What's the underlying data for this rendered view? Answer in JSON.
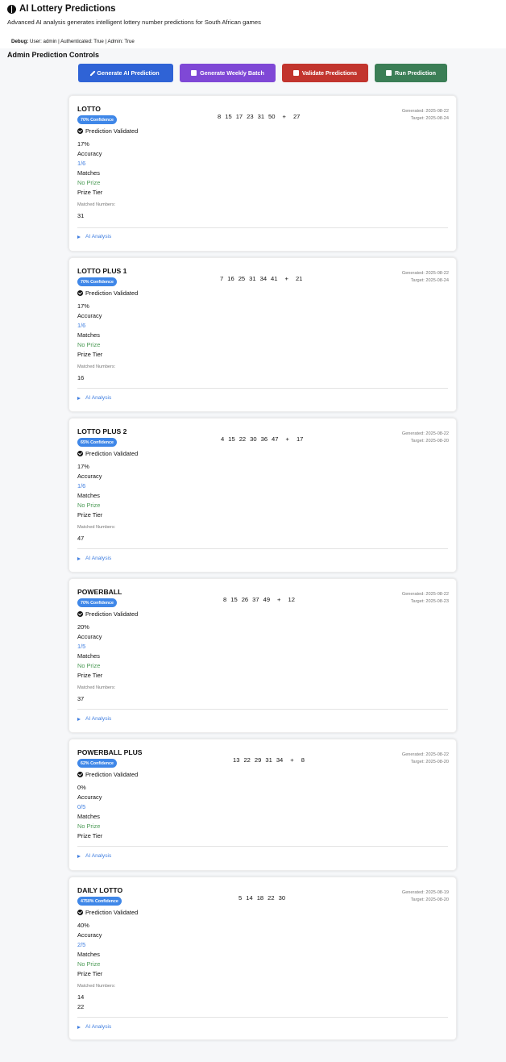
{
  "app": {
    "title": "AI Lottery Predictions",
    "subtitle": "Advanced AI analysis generates intelligent lottery number predictions for South African games",
    "debug_label": "Debug:",
    "debug_text": "User: admin | Authenticated: True | Admin: True",
    "admin_title": "Admin Prediction Controls"
  },
  "buttons": {
    "generate": "Generate AI Prediction",
    "weekly": "Generate Weekly Batch",
    "validate": "Validate Predictions",
    "run": "Run Prediction"
  },
  "labels": {
    "validated": "Prediction Validated",
    "accuracy": "Accuracy",
    "matches": "Matches",
    "prize_tier": "Prize Tier",
    "matched_numbers": "Matched Numbers:",
    "ai_analysis": "AI Analysis"
  },
  "cards": [
    {
      "name": "LOTTO",
      "confidence": "70% Confidence",
      "numbers": [
        "8",
        "15",
        "17",
        "23",
        "31",
        "50"
      ],
      "plus": "+",
      "bonus": "27",
      "generated": "Generated: 2025-08-22",
      "target": "Target: 2025-08-24",
      "accuracy": "17%",
      "matches": "1/6",
      "prize": "No Prize",
      "matched": [
        "31"
      ]
    },
    {
      "name": "LOTTO PLUS 1",
      "confidence": "70% Confidence",
      "numbers": [
        "7",
        "16",
        "25",
        "31",
        "34",
        "41"
      ],
      "plus": "+",
      "bonus": "21",
      "generated": "Generated: 2025-08-22",
      "target": "Target: 2025-08-24",
      "accuracy": "17%",
      "matches": "1/6",
      "prize": "No Prize",
      "matched": [
        "16"
      ]
    },
    {
      "name": "LOTTO PLUS 2",
      "confidence": "65% Confidence",
      "numbers": [
        "4",
        "15",
        "22",
        "30",
        "36",
        "47"
      ],
      "plus": "+",
      "bonus": "17",
      "generated": "Generated: 2025-08-22",
      "target": "Target: 2025-08-20",
      "accuracy": "17%",
      "matches": "1/6",
      "prize": "No Prize",
      "matched": [
        "47"
      ]
    },
    {
      "name": "POWERBALL",
      "confidence": "70% Confidence",
      "numbers": [
        "8",
        "15",
        "26",
        "37",
        "49"
      ],
      "plus": "+",
      "bonus": "12",
      "generated": "Generated: 2025-08-22",
      "target": "Target: 2025-08-23",
      "accuracy": "20%",
      "matches": "1/5",
      "prize": "No Prize",
      "matched": [
        "37"
      ]
    },
    {
      "name": "POWERBALL PLUS",
      "confidence": "62% Confidence",
      "numbers": [
        "13",
        "22",
        "29",
        "31",
        "34"
      ],
      "plus": "+",
      "bonus": "8",
      "generated": "Generated: 2025-08-22",
      "target": "Target: 2025-08-20",
      "accuracy": "0%",
      "matches": "0/5",
      "prize": "No Prize",
      "matched": []
    },
    {
      "name": "DAILY LOTTO",
      "confidence": "4750% Confidence",
      "numbers": [
        "5",
        "14",
        "18",
        "22",
        "30"
      ],
      "plus": "",
      "bonus": "",
      "generated": "Generated: 2025-08-19",
      "target": "Target: 2025-08-20",
      "accuracy": "40%",
      "matches": "2/5",
      "prize": "No Prize",
      "matched": [
        "14",
        "22"
      ]
    }
  ]
}
